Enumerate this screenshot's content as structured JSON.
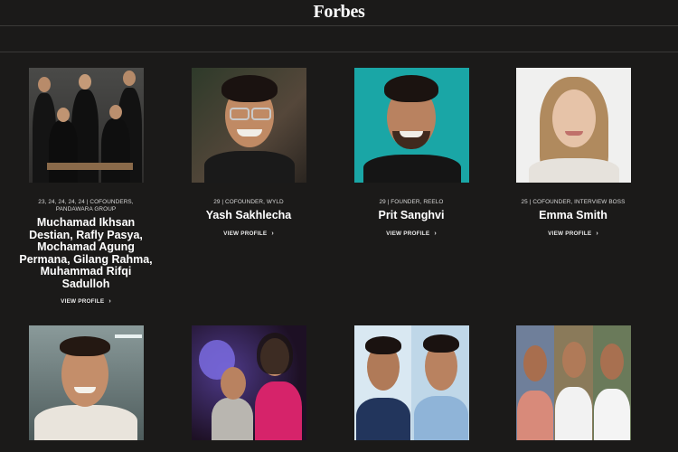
{
  "brand": "Forbes",
  "profiles": [
    {
      "meta": "23, 24, 24, 24, 24 | COFOUNDERS, PANDAWARA GROUP",
      "name": "Muchamad Ikhsan Destian, Rafly Pasya, Mochamad Agung Permana, Gilang Rahma, Muhammad Rifqi Sadulloh",
      "link": "VIEW PROFILE"
    },
    {
      "meta": "29 | COFOUNDER, WYLD",
      "name": "Yash Sakhlecha",
      "link": "VIEW PROFILE"
    },
    {
      "meta": "29 | FOUNDER, REELO",
      "name": "Prit Sanghvi",
      "link": "VIEW PROFILE"
    },
    {
      "meta": "25 | COFOUNDER, INTERVIEW BOSS",
      "name": "Emma Smith",
      "link": "VIEW PROFILE"
    }
  ],
  "chevron": "›",
  "colors": {
    "background": "#1b1a19",
    "teal": "#1aa6a6",
    "text": "#ffffff"
  }
}
